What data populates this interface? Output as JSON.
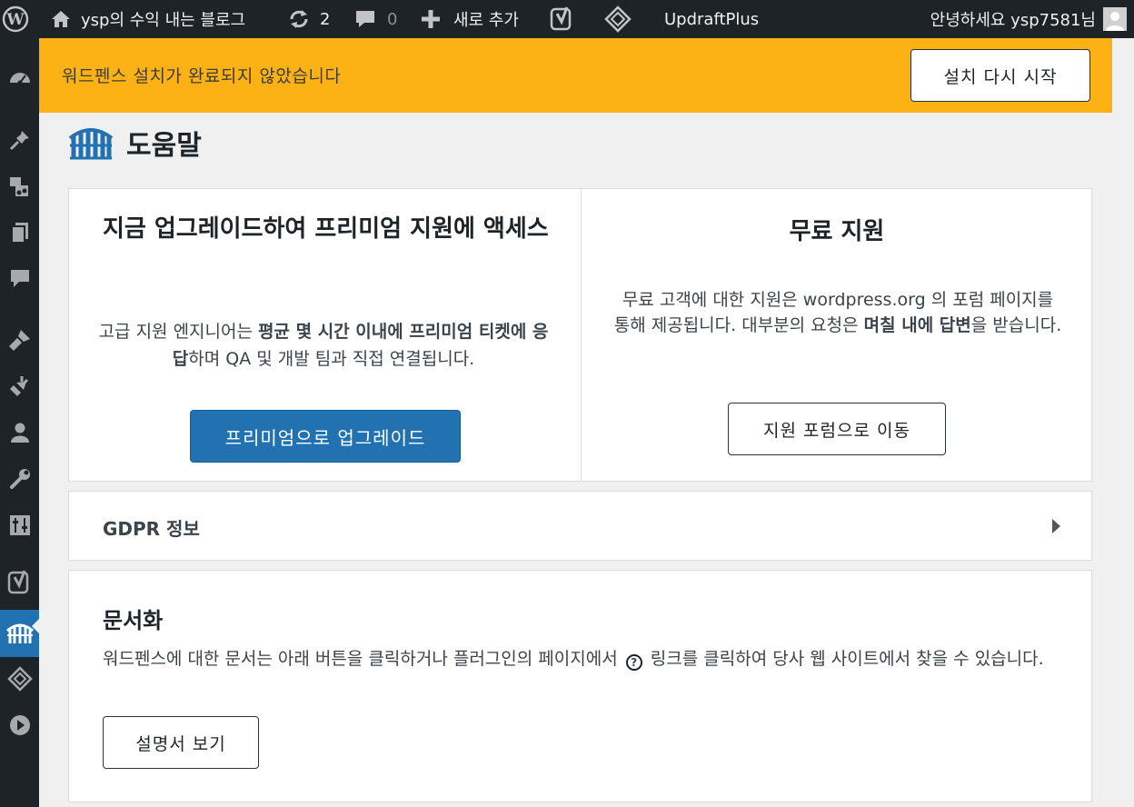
{
  "adminbar": {
    "site_name": "ysp의 수익 내는 블로그",
    "updates_count": "2",
    "comments_count": "0",
    "new_label": "새로 추가",
    "updraft_label": "UpdraftPlus",
    "greeting": "안녕하세요 ysp7581님"
  },
  "notice": {
    "message": "워드펜스 설치가 완료되지 않았습니다",
    "button_label": "설치 다시 시작"
  },
  "page": {
    "title": "도움말"
  },
  "premium": {
    "title": "지금 업그레이드하여 프리미엄 지원에 액세스",
    "text_before": "고급 지원 엔지니어는 ",
    "text_bold": "평균 몇 시간 이내에 프리미엄 티켓에 응답",
    "text_after": "하며 QA 및 개발 팀과 직접 연결됩니다.",
    "button_label": "프리미엄으로 업그레이드"
  },
  "free": {
    "title": "무료 지원",
    "text_before": "무료 고객에 대한 지원은 wordpress.org 의 포럼 페이지를 통해 제공됩니다. 대부분의 요청은 ",
    "text_bold": "며칠 내에 답변",
    "text_after": "을 받습니다.",
    "button_label": "지원 포럼으로 이동"
  },
  "gdpr": {
    "title": "GDPR 정보"
  },
  "docs": {
    "title": "문서화",
    "text_before": "워드펜스에 대한 문서는 아래 버튼을 클릭하거나 플러그인의 페이지에서",
    "help_symbol": "?",
    "text_after": "링크를 클릭하여 당사 웹 사이트에서 찾을 수 있습니다.",
    "button_label": "설명서 보기"
  },
  "sidebar": {
    "icons": [
      "dashboard-icon",
      "pin-icon",
      "media-icon",
      "pages-icon",
      "comments-icon",
      "appearance-icon",
      "plugins-icon",
      "users-icon",
      "tools-icon",
      "settings-icon",
      "yoast-icon",
      "wordfence-icon",
      "updraft-icon",
      "play-icon"
    ],
    "active": "wordfence-icon"
  },
  "colors": {
    "adminbar_bg": "#1d2327",
    "notice_bg": "#fcb214",
    "primary": "#2271b1"
  }
}
